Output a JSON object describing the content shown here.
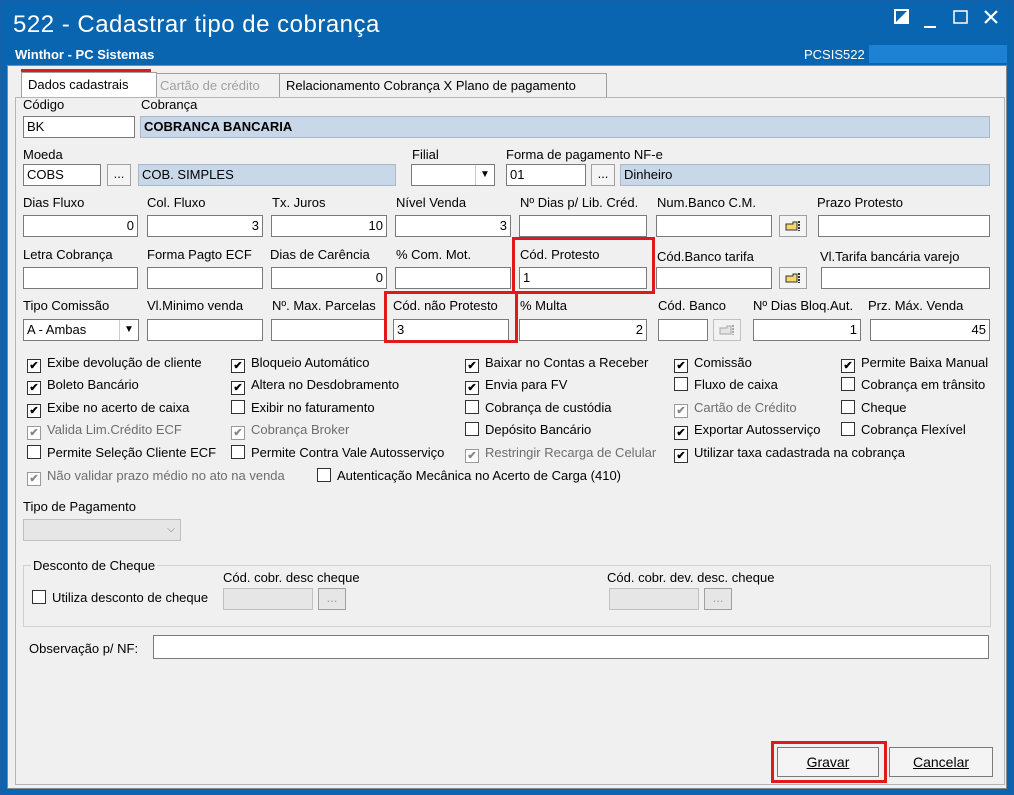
{
  "window": {
    "title": "522 - Cadastrar tipo de cobrança",
    "subtitle": "Winthor - PC Sistemas",
    "code": "PCSIS522"
  },
  "tabs": [
    {
      "label": "Dados cadastrais"
    },
    {
      "label": "Cartão de crédito"
    },
    {
      "label": "Relacionamento Cobrança X Plano de pagamento"
    }
  ],
  "fields": {
    "codigo": {
      "label": "Código",
      "value": "BK"
    },
    "cobranca": {
      "label": "Cobrança",
      "value": "COBRANCA BANCARIA"
    },
    "moeda": {
      "label": "Moeda",
      "value": "COBS",
      "desc": "COB. SIMPLES"
    },
    "filial": {
      "label": "Filial",
      "value": ""
    },
    "forma_pag": {
      "label": "Forma de pagamento NF-e",
      "value": "01",
      "desc": "Dinheiro"
    },
    "dias_fluxo": {
      "label": "Dias Fluxo",
      "value": "0"
    },
    "col_fluxo": {
      "label": "Col. Fluxo",
      "value": "3"
    },
    "tx_juros": {
      "label": "Tx. Juros",
      "value": "10"
    },
    "nivel_venda": {
      "label": "Nível Venda",
      "value": "3"
    },
    "dias_lib": {
      "label": "Nº Dias p/ Lib. Créd.",
      "value": ""
    },
    "num_banco_cm": {
      "label": "Num.Banco C.M.",
      "value": ""
    },
    "prazo_protesto": {
      "label": "Prazo Protesto",
      "value": ""
    },
    "letra_cobranca": {
      "label": "Letra Cobrança",
      "value": ""
    },
    "forma_ecf": {
      "label": "Forma Pagto ECF",
      "value": ""
    },
    "dias_carencia": {
      "label": "Dias de Carência",
      "value": "0"
    },
    "com_mot": {
      "label": "% Com. Mot.",
      "value": ""
    },
    "cod_protesto": {
      "label": "Cód. Protesto",
      "value": "1"
    },
    "cod_banco_tarifa": {
      "label": "Cód.Banco tarifa",
      "value": ""
    },
    "vl_tarifa": {
      "label": "Vl.Tarifa bancária varejo",
      "value": ""
    },
    "tipo_comissao": {
      "label": "Tipo Comissão",
      "value": "A - Ambas"
    },
    "vl_min_venda": {
      "label": "Vl.Minimo venda",
      "value": ""
    },
    "max_parcelas": {
      "label": "Nº. Max. Parcelas",
      "value": ""
    },
    "cod_nao_protesto": {
      "label": "Cód. não Protesto",
      "value": "3"
    },
    "multa": {
      "label": "% Multa",
      "value": "2"
    },
    "cod_banco": {
      "label": "Cód. Banco",
      "value": ""
    },
    "dias_bloq": {
      "label": "Nº Dias Bloq.Aut.",
      "value": "1"
    },
    "prz_max_venda": {
      "label": "Prz. Máx. Venda",
      "value": "45"
    }
  },
  "checkboxes": {
    "c1": {
      "label": "Exibe devolução de cliente",
      "checked": "✔"
    },
    "c2": {
      "label": "Bloqueio Automático",
      "checked": "✔"
    },
    "c3": {
      "label": "Baixar no Contas a Receber",
      "checked": "✔"
    },
    "c4": {
      "label": "Comissão",
      "checked": "✔"
    },
    "c5": {
      "label": "Permite Baixa Manual",
      "checked": "✔"
    },
    "c6": {
      "label": "Boleto Bancário",
      "checked": "✔"
    },
    "c7": {
      "label": "Altera no Desdobramento",
      "checked": "✔"
    },
    "c8": {
      "label": "Envia para FV",
      "checked": "✔"
    },
    "c9": {
      "label": "Fluxo de caixa",
      "checked": ""
    },
    "c10": {
      "label": "Cobrança em trânsito",
      "checked": ""
    },
    "c11": {
      "label": "Exibe no acerto de caixa",
      "checked": "✔"
    },
    "c12": {
      "label": "Exibir no faturamento",
      "checked": ""
    },
    "c13": {
      "label": "Cobrança de custódia",
      "checked": ""
    },
    "c14": {
      "label": "Cartão de Crédito",
      "checked": "✔"
    },
    "c15": {
      "label": "Cheque",
      "checked": ""
    },
    "c16": {
      "label": "Valida Lim.Crédito ECF",
      "checked": "✔"
    },
    "c17": {
      "label": "Cobrança Broker",
      "checked": "✔"
    },
    "c18": {
      "label": "Depósito Bancário",
      "checked": ""
    },
    "c19": {
      "label": "Exportar Autosserviço",
      "checked": "✔"
    },
    "c20": {
      "label": "Cobrança Flexível",
      "checked": ""
    },
    "c21": {
      "label": "Permite Seleção Cliente ECF",
      "checked": ""
    },
    "c22": {
      "label": "Permite Contra Vale Autosserviço",
      "checked": ""
    },
    "c23": {
      "label": "Restringir Recarga de Celular",
      "checked": "✔"
    },
    "c24": {
      "label": "Utilizar taxa cadastrada na cobrança",
      "checked": "✔"
    },
    "c25": {
      "label": "Não validar prazo médio no ato na venda",
      "checked": "✔"
    },
    "c26": {
      "label": "Autenticação Mecânica no Acerto de Carga (410)",
      "checked": ""
    }
  },
  "tipo_pagamento": {
    "label": "Tipo de Pagamento",
    "value": ""
  },
  "desconto_cheque": {
    "title": "Desconto de Cheque",
    "utiliza_label": "Utiliza desconto de cheque",
    "cod_desc_label": "Cód. cobr. desc cheque",
    "cod_dev_label": "Cód. cobr. dev. desc. cheque"
  },
  "observacao": {
    "label": "Observação p/ NF:",
    "value": ""
  },
  "buttons": {
    "gravar": "Gravar",
    "cancelar": "Cancelar",
    "dots": "..."
  },
  "colors": {
    "titlebar": "#0965b0",
    "highlight": "#e0191a",
    "readonly": "#c9d8e8"
  }
}
